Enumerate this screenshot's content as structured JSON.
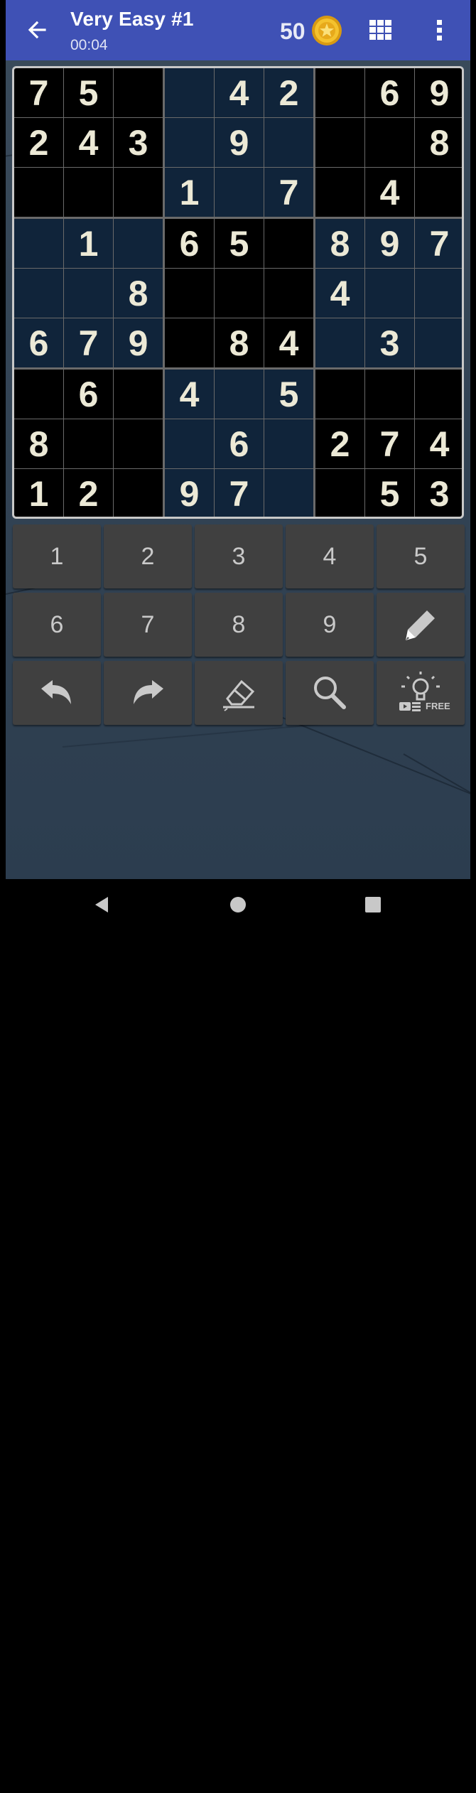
{
  "header": {
    "title": "Very Easy #1",
    "timer": "00:04",
    "coins": "50",
    "icons": [
      "arrow-left-icon",
      "coin-icon",
      "grid-icon",
      "more-vert-icon"
    ]
  },
  "board": {
    "rows": [
      [
        "7",
        "5",
        "",
        "",
        "4",
        "2",
        "",
        "6",
        "9"
      ],
      [
        "2",
        "4",
        "3",
        "",
        "9",
        "",
        "",
        "",
        "8"
      ],
      [
        "",
        "",
        "",
        "1",
        "",
        "7",
        "",
        "4",
        ""
      ],
      [
        "",
        "1",
        "",
        "6",
        "5",
        "",
        "8",
        "9",
        "7"
      ],
      [
        "",
        "",
        "8",
        "",
        "",
        "",
        "4",
        "",
        ""
      ],
      [
        "6",
        "7",
        "9",
        "",
        "8",
        "4",
        "",
        "3",
        ""
      ],
      [
        "",
        "6",
        "",
        "4",
        "",
        "5",
        "",
        "",
        ""
      ],
      [
        "8",
        "",
        "",
        "",
        "6",
        "",
        "2",
        "7",
        "4"
      ],
      [
        "1",
        "2",
        "",
        "9",
        "7",
        "",
        "",
        "5",
        "3"
      ]
    ],
    "colors": {
      "dark_cell": "#000000",
      "highlight_cell": "#10243a",
      "digit": "#ece9d6"
    }
  },
  "keypad": {
    "digits": [
      "1",
      "2",
      "3",
      "4",
      "5",
      "6",
      "7",
      "8",
      "9"
    ],
    "tools": [
      "pencil-icon",
      "undo-icon",
      "redo-icon",
      "eraser-icon",
      "search-icon",
      "hint-icon"
    ],
    "hint_badge": "FREE"
  },
  "theme": {
    "toolbar": "#3f51b5",
    "key": "#404040",
    "key_text": "#c9c9c9"
  }
}
